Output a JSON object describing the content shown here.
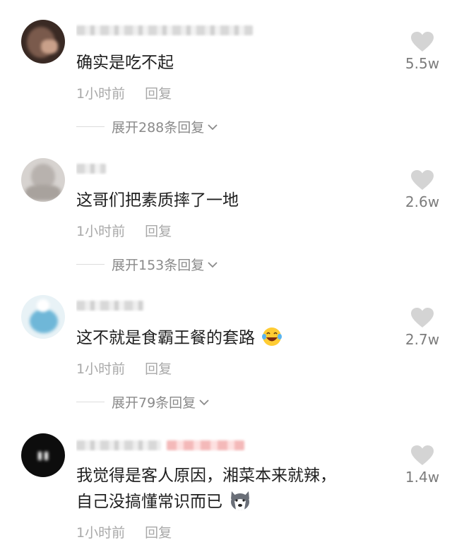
{
  "comments": [
    {
      "text": "确实是吃不起",
      "time": "1小时前",
      "reply_label": "回复",
      "expand": "展开288条回复",
      "likes": "5.5w"
    },
    {
      "text": "这哥们把素质摔了一地",
      "time": "1小时前",
      "reply_label": "回复",
      "expand": "展开153条回复",
      "likes": "2.6w"
    },
    {
      "text": "这不就是食霸王餐的套路",
      "time": "1小时前",
      "reply_label": "回复",
      "expand": "展开79条回复",
      "likes": "2.7w",
      "emoji": "laughing-tears-emoji"
    },
    {
      "text_line1": "我觉得是客人原因，湘菜本来就辣，",
      "text_line2": "自己没搞懂常识而已",
      "time": "1小时前",
      "reply_label": "回复",
      "likes": "1.4w",
      "emoji": "husky-dog-emoji"
    }
  ],
  "icons": {
    "like": "heart-icon",
    "expand": "chevron-down-icon"
  },
  "colors": {
    "text": "#1f1f1f",
    "meta": "#a8a8a8",
    "heart": "#d4d4d4"
  }
}
